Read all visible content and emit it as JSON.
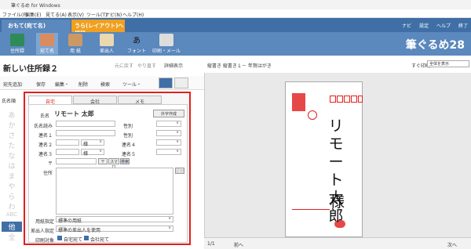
{
  "app": {
    "title": "筆ぐるめ for Windows",
    "logo": "筆ぐるめ28"
  },
  "menu": [
    "ファイル(F)",
    "編集(E)",
    "見てる(A)",
    "表示(V)",
    "ツール(T)",
    "ナビ(N)",
    "ヘルプ(H)"
  ],
  "modes": {
    "front": "おもて(宛て名)",
    "back": "うら(レイアウト)へ切替"
  },
  "top_links": [
    "ナビ",
    "設定",
    "ヘルプ",
    "終了"
  ],
  "toolbar": [
    "住所録",
    "宛て名",
    "用 紙",
    "差出人",
    "フォント",
    "印刷・メール"
  ],
  "left": {
    "book_name": "新しい住所録２",
    "undo": "元に戻す",
    "redo": "やり直す",
    "detail": "詳細表示",
    "actions": [
      "宛先追加",
      "保存",
      "編集・",
      "削除",
      "検索",
      "ツール・"
    ],
    "sort": "氏名順",
    "kana": [
      "あ",
      "か",
      "さ",
      "た",
      "な",
      "は",
      "ま",
      "や",
      "ら",
      "わ",
      "ABC",
      "他",
      "全"
    ]
  },
  "dialog": {
    "tabs": [
      "自宅",
      "会社",
      "メモ"
    ],
    "name_label": "氏名",
    "name_value": "リモート 太郎",
    "gaiji": "外字作成",
    "yomi": "氏名読み",
    "seibetsu": "性別",
    "rows": [
      {
        "l": "連名１",
        "s": "様",
        "l2": "性別"
      },
      {
        "l": "連名２",
        "s": "様",
        "l2": "連名４"
      },
      {
        "l": "連名３",
        "s": "様",
        "l2": "連名５"
      }
    ],
    "zip": "〒",
    "zip_btn": "〒",
    "smart": "スマ口",
    "search": "検索",
    "addr": "住所",
    "addr_btn": "区切",
    "paper_label": "用紙指定",
    "paper_value": "標準の用紙",
    "sender_label": "差出人指定",
    "sender_value": "標準の差出人を使用",
    "print_label": "印刷対象",
    "home_print": "自宅宛て",
    "office_print": "会社宛て"
  },
  "right": {
    "header": "縦書き 縦書き１－ 年賀はがき",
    "zoom_label": "すぐ印刷",
    "zoom_value": "全体を表示",
    "card_name": "リモート太郎",
    "honorific": "様",
    "page": "1/1",
    "prev": "前へ",
    "next": "次へ"
  }
}
